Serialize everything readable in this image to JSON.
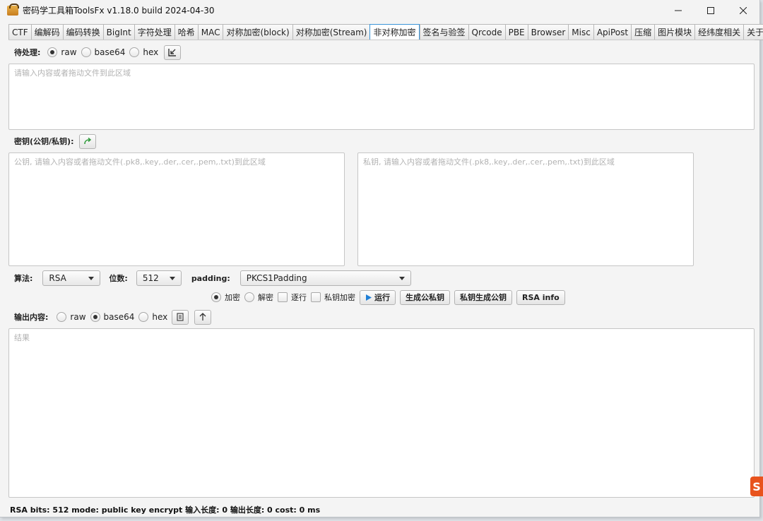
{
  "window": {
    "title": "密码学工具箱ToolsFx v1.18.0 build 2024-04-30"
  },
  "tabs": [
    "CTF",
    "编解码",
    "编码转换",
    "BigInt",
    "字符处理",
    "哈希",
    "MAC",
    "对称加密(block)",
    "对称加密(Stream)",
    "非对称加密",
    "签名与验签",
    "Qrcode",
    "PBE",
    "Browser",
    "Misc",
    "ApiPost",
    "压缩",
    "图片模块",
    "经纬度相关",
    "关于"
  ],
  "active_tab": "非对称加密",
  "input_section": {
    "label": "待处理:",
    "options": [
      "raw",
      "base64",
      "hex"
    ],
    "selected": "raw",
    "placeholder": "请输入内容或者拖动文件到此区域"
  },
  "key_section": {
    "label": "密钥(公钥/私钥):",
    "public_placeholder": "公钥, 请输入内容或者拖动文件(.pk8,.key,.der,.cer,.pem,.txt)到此区域",
    "private_placeholder": "私钥, 请输入内容或者拖动文件(.pk8,.key,.der,.cer,.pem,.txt)到此区域"
  },
  "algo_row": {
    "algo_label": "算法:",
    "algo_value": "RSA",
    "bits_label": "位数:",
    "bits_value": "512",
    "padding_label": "padding:",
    "padding_value": "PKCS1Padding"
  },
  "action_row": {
    "encrypt_label": "加密",
    "decrypt_label": "解密",
    "line_by_line_label": "逐行",
    "private_encrypt_label": "私钥加密",
    "run_label": "运行",
    "gen_keypair_label": "生成公私钥",
    "private_gen_public_label": "私钥生成公钥",
    "rsa_info_label": "RSA info",
    "mode_selected": "加密"
  },
  "output_section": {
    "label": "输出内容:",
    "options": [
      "raw",
      "base64",
      "hex"
    ],
    "selected": "base64",
    "placeholder": "结果"
  },
  "status_bar": {
    "text": "RSA  bits: 512  mode: public key encrypt  输入长度: 0  输出长度: 0  cost: 0 ms"
  },
  "colors": {
    "active_tab_border": "#3b95d8",
    "run_icon": "#1f7fd6",
    "key_swap_icon": "#2e9a3a"
  }
}
